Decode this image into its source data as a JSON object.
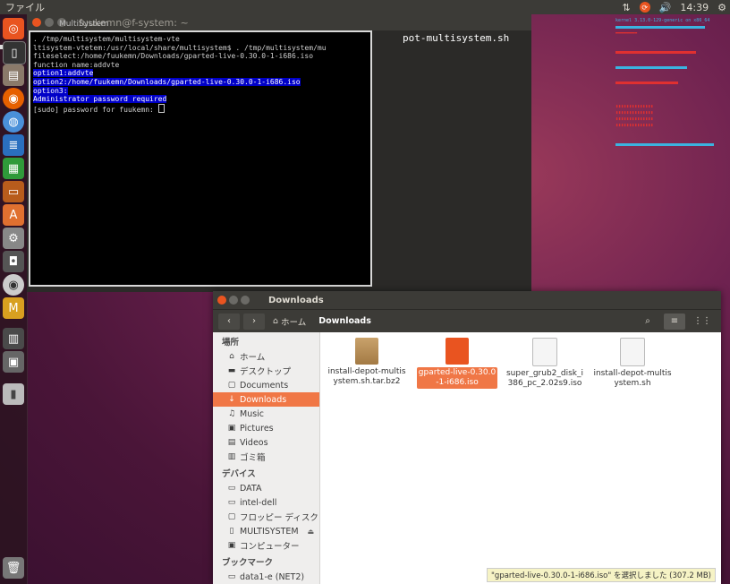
{
  "top_panel": {
    "menu_label": "ファイル",
    "clock": "14:39",
    "icons": [
      "network-icon",
      "update-icon",
      "volume-icon",
      "gear-icon"
    ]
  },
  "launcher": {
    "items": [
      "dash-icon",
      "terminal-icon",
      "files-icon",
      "firefox-icon",
      "chromium-icon",
      "writer-icon",
      "calc-icon",
      "impress-icon",
      "software-center-icon",
      "settings-icon",
      "screenshot-icon",
      "disc-icon",
      "multisystem-icon",
      "workspace-icon",
      "save-icon",
      "usb-icon",
      "trash-icon"
    ]
  },
  "background_terminal": {
    "title": "fuukemn@f-system: ~",
    "partial_command": "pot-multisystem.sh"
  },
  "terminal": {
    "title": "MultiSystem",
    "lines": [
      ". /tmp/multisystem/multisystem-vte",
      "ltisystem-vtetem:/usr/local/share/multisystem$ . /tmp/multisystem/mu",
      "fileselect:/home/fuukemn/Downloads/gparted-live-0.30.0-1-i686.iso",
      "function name:addvte"
    ],
    "highlighted_lines": [
      "option1:addvte",
      "option2:/home/fuukemn/Downloads/gparted-live-0.30.0-1-i686.iso",
      "option3:",
      "Administrator password required"
    ],
    "prompt": "[sudo] password for fuukemn: "
  },
  "files_window": {
    "title": "Downloads",
    "breadcrumb_home": "ホーム",
    "breadcrumb_current": "Downloads",
    "sidebar": {
      "places_heading": "場所",
      "places": [
        {
          "icon": "home-icon",
          "label": "ホーム"
        },
        {
          "icon": "desktop-icon",
          "label": "デスクトップ"
        },
        {
          "icon": "documents-icon",
          "label": "Documents"
        },
        {
          "icon": "downloads-icon",
          "label": "Downloads"
        },
        {
          "icon": "music-icon",
          "label": "Music"
        },
        {
          "icon": "pictures-icon",
          "label": "Pictures"
        },
        {
          "icon": "videos-icon",
          "label": "Videos"
        },
        {
          "icon": "trash-icon",
          "label": "ゴミ箱"
        }
      ],
      "devices_heading": "デバイス",
      "devices": [
        {
          "icon": "drive-icon",
          "label": "DATA"
        },
        {
          "icon": "drive-icon",
          "label": "intel-dell"
        },
        {
          "icon": "floppy-icon",
          "label": "フロッピー ディスク"
        },
        {
          "icon": "usb-drive-icon",
          "label": "MULTISYSTEM"
        },
        {
          "icon": "computer-icon",
          "label": "コンピューター"
        }
      ],
      "bookmarks_heading": "ブックマーク",
      "bookmarks": [
        {
          "icon": "network-drive-icon",
          "label": "data1-e (NET2)"
        }
      ]
    },
    "files": [
      {
        "name": "install-depot-multisystem.sh.tar.bz2",
        "icon": "archive-icon"
      },
      {
        "name": "gparted-live-0.30.0-1-i686.iso",
        "icon": "iso-icon",
        "selected": true
      },
      {
        "name": "super_grub2_disk_i386_pc_2.02s9.iso",
        "icon": "iso-icon"
      },
      {
        "name": "install-depot-multisystem.sh",
        "icon": "script-icon"
      }
    ],
    "status": "\"gparted-live-0.30.0-1-i686.iso\" を選択しました (307.2 MB)"
  },
  "colors": {
    "accent": "#f07746",
    "terminal_highlight": "#0000c8",
    "panel": "#3c3b37"
  }
}
